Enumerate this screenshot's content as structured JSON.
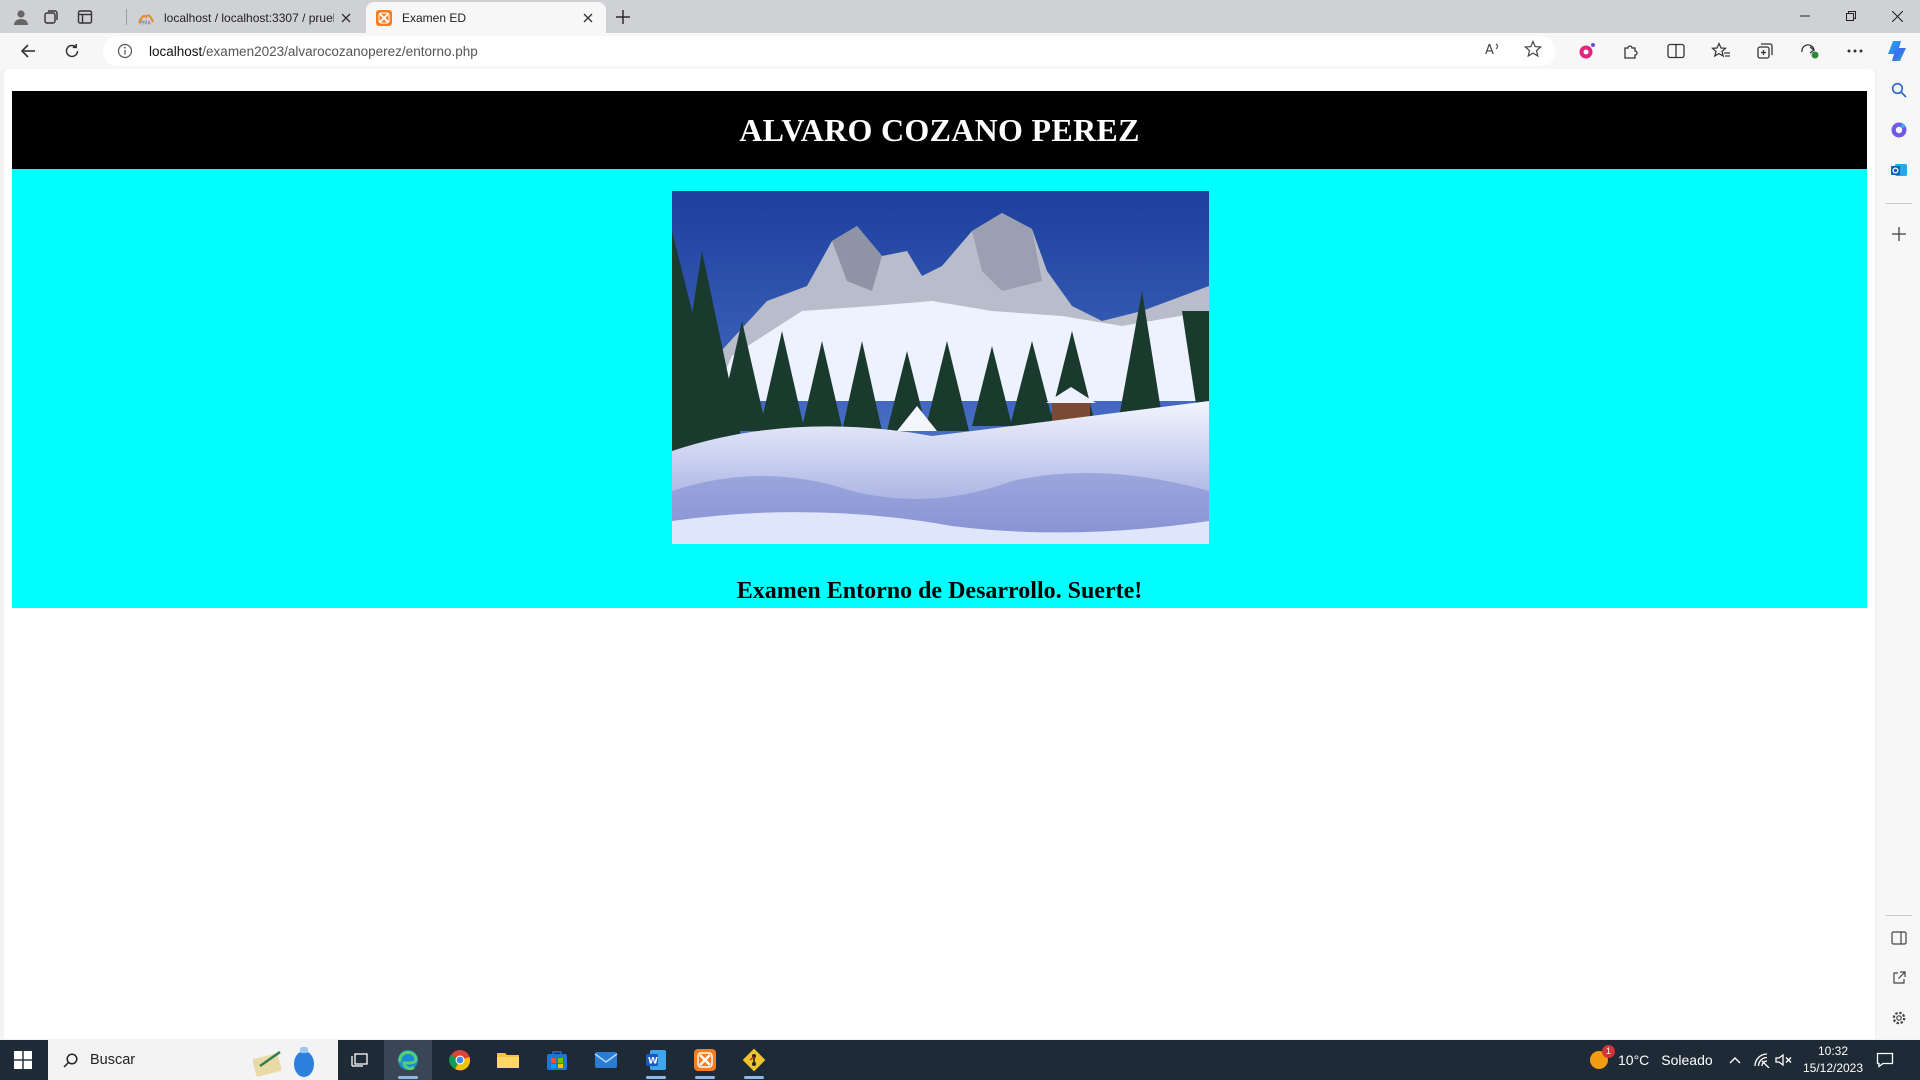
{
  "browser": {
    "tabs": [
      {
        "title": "localhost / localhost:3307 / prueb",
        "favicon": "phpmyadmin-icon",
        "active": false
      },
      {
        "title": "Examen ED",
        "favicon": "xampp-icon",
        "active": true
      }
    ],
    "address": {
      "host": "localhost",
      "path": "/examen2023/alvarocozanoperez/entorno.php"
    }
  },
  "page": {
    "header_title": "ALVARO COZANO PEREZ",
    "image_description": "snowy-mountain-landscape",
    "body_text": "Examen Entorno de Desarrollo. Suerte!",
    "colors": {
      "header_bg": "#000000",
      "header_text": "#ffffff",
      "body_bg": "#00ffff"
    }
  },
  "taskbar": {
    "search_placeholder": "Buscar",
    "weather": {
      "temperature": "10°C",
      "condition": "Soleado",
      "badge": "1"
    },
    "clock": {
      "time": "10:32",
      "date": "15/12/2023"
    }
  }
}
